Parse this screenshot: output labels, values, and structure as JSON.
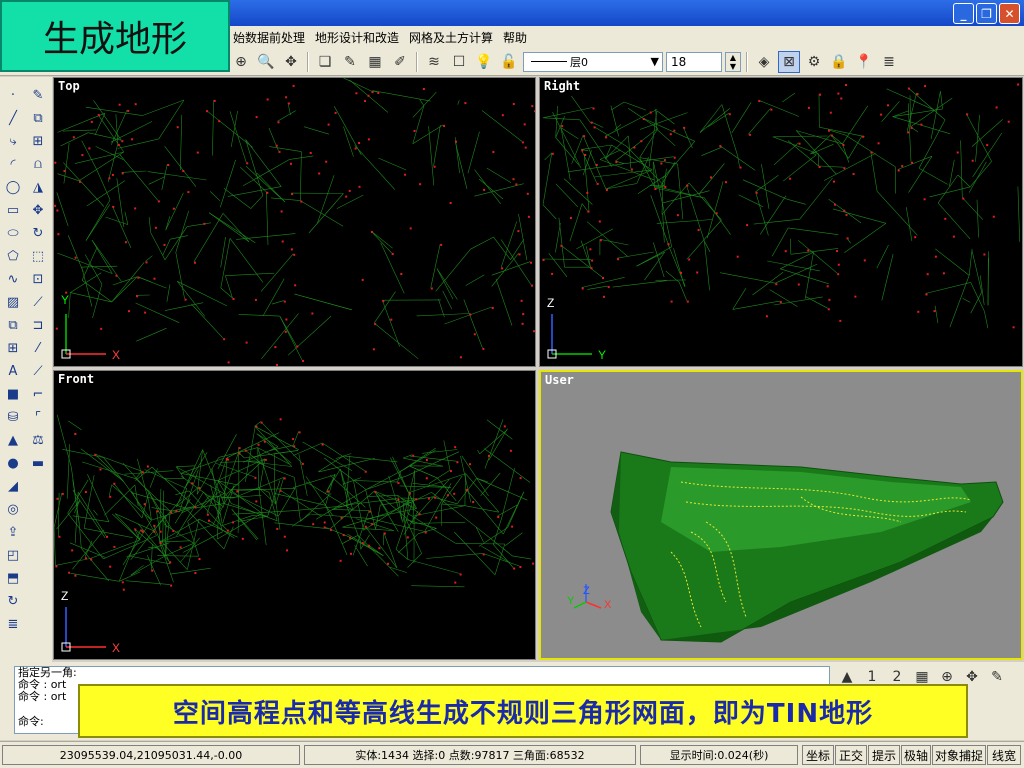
{
  "slide_title": "生成地形",
  "menu": [
    "始数据前处理",
    "地形设计和改造",
    "网格及土方计算",
    "帮助"
  ],
  "toolbar": {
    "layer_value": "层0",
    "lineweight_value": "18"
  },
  "viewports": {
    "top": "Top",
    "right": "Right",
    "front": "Front",
    "user": "User"
  },
  "axes": {
    "top": {
      "v": "Y",
      "h": "X"
    },
    "right": {
      "v": "Z",
      "h": "Y"
    },
    "front": {
      "v": "Z",
      "h": "X"
    },
    "user": {
      "z": "Z",
      "y": "Y",
      "x": "X"
    }
  },
  "command": {
    "lines": [
      "指定另一角:",
      "命令 : ort",
      "命令 : ort"
    ],
    "prompt": "命令:"
  },
  "caption": "空间高程点和等高线生成不规则三角形网面，即为TIN地形",
  "status": {
    "coords": "23095539.04,21095031.44,-0.00",
    "info": "实体:1434 选择:0 点数:97817 三角面:68532",
    "time": "显示时间:0.024(秒)",
    "buttons": [
      "坐标",
      "正交",
      "提示",
      "极轴",
      "对象捕捉",
      "线宽"
    ]
  },
  "colors": {
    "mesh": "#1e8a1e",
    "points": "#e02020",
    "viewport_bg": "#000000",
    "user_bg": "#8c8c8c",
    "active_border": "#e6e600",
    "caption_bg": "#ffff24",
    "caption_text": "#1a2aa8"
  }
}
